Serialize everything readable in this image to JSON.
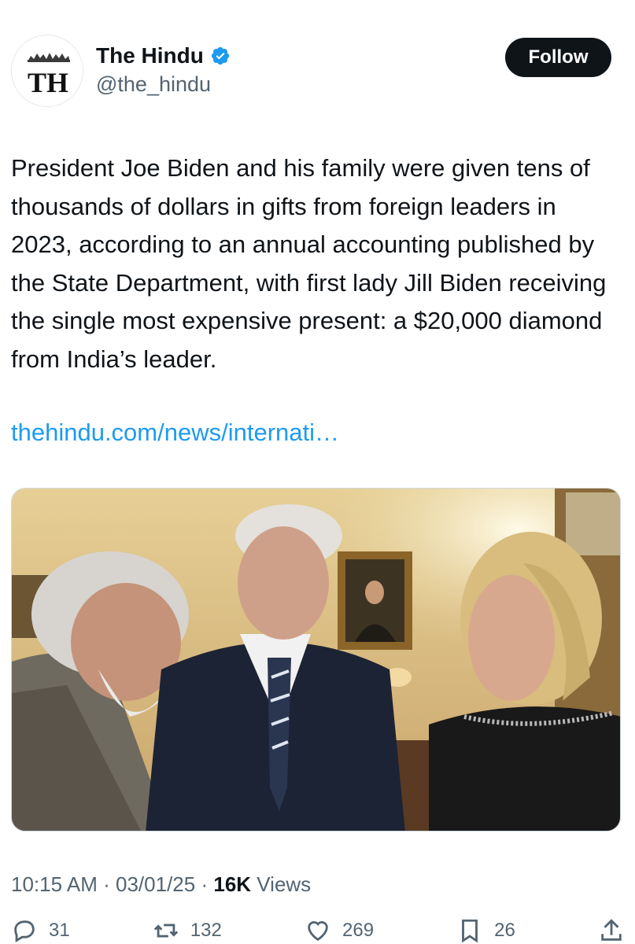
{
  "account": {
    "display_name": "The Hindu",
    "handle": "@the_hindu",
    "avatar_text": "TH",
    "verified": true
  },
  "header": {
    "follow_label": "Follow"
  },
  "tweet": {
    "text": "President Joe Biden and his family were given tens of thousands of dollars in gifts from foreign leaders in 2023, according to an annual accounting published by the State Department, with first lady Jill Biden receiving the single most expensive present: a $20,000 diamond from India’s leader.",
    "link": "thehindu.com/news/internati…"
  },
  "meta": {
    "time": "10:15 AM",
    "date": "03/01/25",
    "views_count": "16K",
    "views_label": "Views",
    "separator": "·"
  },
  "actions": {
    "replies": "31",
    "reposts": "132",
    "likes": "269",
    "bookmarks": "26"
  },
  "colors": {
    "text": "#0f1419",
    "secondary": "#536471",
    "link": "#1d9bf0",
    "button_bg": "#0f1419",
    "verified": "#1d9bf0"
  }
}
